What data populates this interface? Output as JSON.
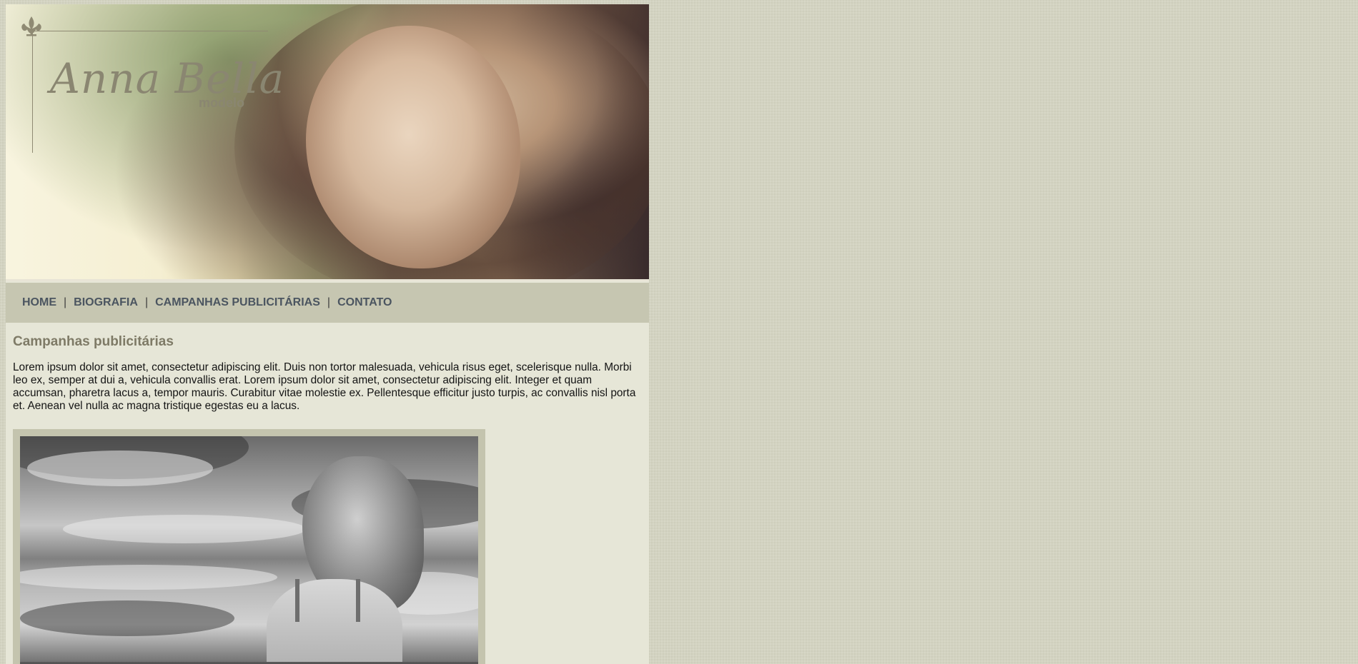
{
  "header": {
    "logo_name": "Anna Bella",
    "logo_subtitle": "modelo",
    "logo_icon": "fleur-de-lis-icon",
    "banner_image": "portrait-woman-hand-in-hair"
  },
  "nav": {
    "items": [
      {
        "label": "HOME"
      },
      {
        "label": "BIOGRAFIA"
      },
      {
        "label": "CAMPANHAS PUBLICITÁRIAS"
      },
      {
        "label": "CONTATO"
      }
    ],
    "separator": "|"
  },
  "main": {
    "title": "Campanhas publicitárias",
    "intro": "Lorem ipsum dolor sit amet, consectetur adipiscing elit. Duis non tortor malesuada, vehicula risus eget, scelerisque nulla. Morbi leo ex, semper at dui a, vehicula convallis erat. Lorem ipsum dolor sit amet, consectetur adipiscing elit. Integer et quam accumsan, pharetra lacus a, tempor mauris. Curabitur vitae molestie ex. Pellentesque efficitur justo turpis, ac convallis nisl porta et. Aenean vel nulla ac magna tristique egestas eu a lacus.",
    "photo": "black-and-white-woman-clouds"
  },
  "colors": {
    "page_background": "#d3d3c1",
    "content_background": "#e6e6d7",
    "nav_background": "#c6c6b1",
    "nav_link": "#4b5560",
    "title": "#7e7a66",
    "logo": "#8a8671"
  }
}
